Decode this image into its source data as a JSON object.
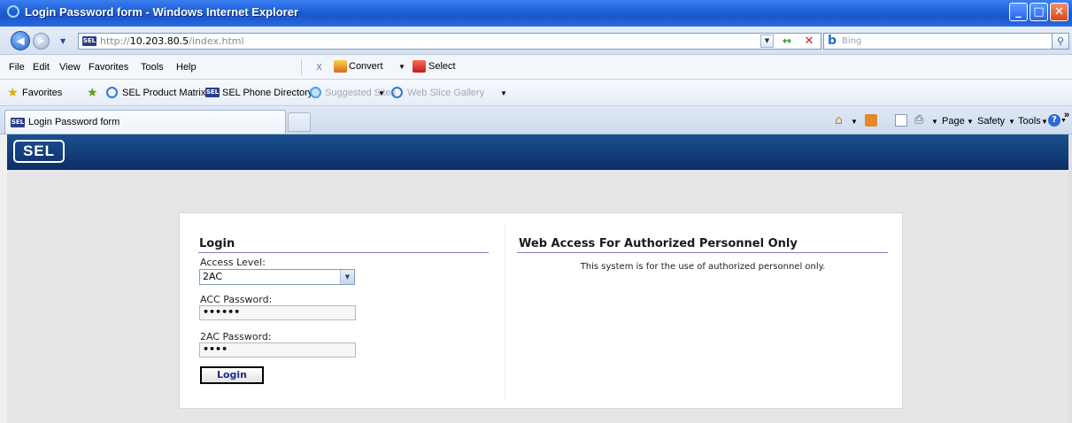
{
  "window": {
    "title": "Login Password form - Windows Internet Explorer",
    "min_glyph": "_",
    "max_glyph": "□",
    "close_glyph": "✕"
  },
  "address_bar": {
    "favicon": "SEL",
    "url_prefix": "http://",
    "url_host": "10.203.80.5",
    "url_path": "/index.html",
    "search_placeholder": "Bing",
    "search_icon": "search-icon"
  },
  "menu": {
    "items": [
      "File",
      "Edit",
      "View",
      "Favorites",
      "Tools",
      "Help"
    ],
    "toolbar_close": "x",
    "convert_label": "Convert",
    "select_label": "Select"
  },
  "favorites_bar": {
    "favorites_label": "Favorites",
    "items": [
      {
        "label": "SEL Product Matrix",
        "icon": "ie-page-icon"
      },
      {
        "label": "SEL Phone Directory",
        "icon": "sel-favicon"
      },
      {
        "label": "Suggested Sites",
        "icon": "suggested-sites-icon"
      },
      {
        "label": "Web Slice Gallery",
        "icon": "ie-page-icon"
      }
    ]
  },
  "tabs": {
    "active_title": "Login Password form",
    "commands": [
      "Page",
      "Safety",
      "Tools"
    ],
    "overflow": "»"
  },
  "banner": {
    "logo_text": "SEL"
  },
  "login": {
    "heading": "Login",
    "access_level_label": "Access Level:",
    "access_level_value": "2AC",
    "acc_password_label": "ACC Password:",
    "acc_password_value": "••••••",
    "tac_password_label": "2AC Password:",
    "tac_password_value": "••••",
    "submit_label": "Login"
  },
  "notice": {
    "heading": "Web Access For Authorized Personnel Only",
    "text": "This system is for the use of authorized personnel only."
  },
  "colors": {
    "titlebar": "#1f62d8",
    "banner": "#0d2f66",
    "section_rule": "#7d82c7",
    "button_text": "#1b2f8a"
  }
}
